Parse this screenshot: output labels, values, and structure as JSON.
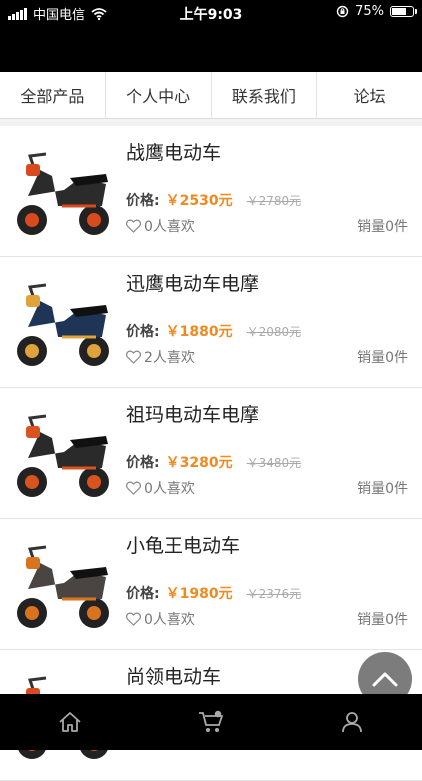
{
  "status_bar": {
    "carrier": "中国电信",
    "time": "上午9:03",
    "battery": "75%",
    "battery_level": 0.75
  },
  "nav": {
    "tabs": [
      {
        "label": "全部产品"
      },
      {
        "label": "个人中心"
      },
      {
        "label": "联系我们"
      },
      {
        "label": "论坛"
      }
    ]
  },
  "price_label": "价格:",
  "products": [
    {
      "name": "战鹰电动车",
      "price": "￥2530元",
      "original_price": "￥2780元",
      "likes": "0人喜欢",
      "sales": "销量0件",
      "body_color": "#2b2b2b",
      "accent_color": "#d94a1e"
    },
    {
      "name": "迅鹰电动车电摩",
      "price": "￥1880元",
      "original_price": "￥2080元",
      "likes": "2人喜欢",
      "sales": "销量0件",
      "body_color": "#1f3558",
      "accent_color": "#e0a23a"
    },
    {
      "name": "祖玛电动车电摩",
      "price": "￥3280元",
      "original_price": "￥3480元",
      "likes": "0人喜欢",
      "sales": "销量0件",
      "body_color": "#2a2a2a",
      "accent_color": "#d9531e"
    },
    {
      "name": "小龟王电动车",
      "price": "￥1980元",
      "original_price": "￥2376元",
      "likes": "0人喜欢",
      "sales": "销量0件",
      "body_color": "#4a4542",
      "accent_color": "#d9731e"
    },
    {
      "name": "尚领电动车",
      "price": "",
      "original_price": "",
      "likes": "",
      "sales": "",
      "body_color": "#2b2b2b",
      "accent_color": "#d94a1e"
    }
  ],
  "tabbar": {
    "items": [
      {
        "icon": "home-icon"
      },
      {
        "icon": "cart-icon"
      },
      {
        "icon": "user-icon"
      }
    ]
  }
}
